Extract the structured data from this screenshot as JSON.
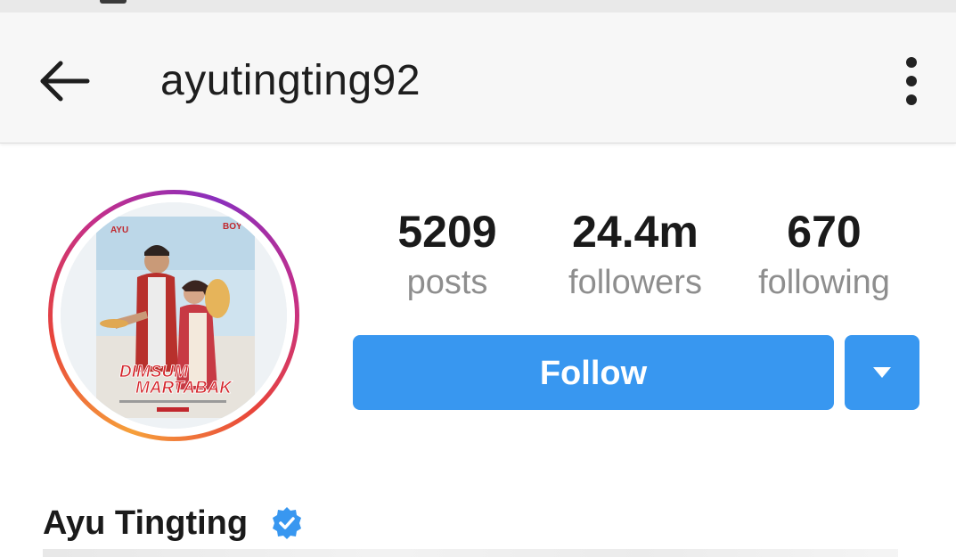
{
  "header": {
    "username": "ayutingting92",
    "back_icon": "arrow-back-icon",
    "menu_icon": "more-vertical-icon"
  },
  "profile": {
    "avatar_icon": "profile-picture",
    "poster_text": {
      "name_left": "AYU",
      "name_right": "BOY",
      "title_line1": "DIMSUM",
      "title_line2": "MARTABAK"
    },
    "full_name": "Ayu Tingting",
    "verified": true,
    "verified_icon": "verified-badge-icon"
  },
  "stats": [
    {
      "value": "5209",
      "label": "posts"
    },
    {
      "value": "24.4m",
      "label": "followers"
    },
    {
      "value": "670",
      "label": "following"
    }
  ],
  "actions": {
    "follow_label": "Follow",
    "dropdown_icon": "caret-down-icon"
  },
  "colors": {
    "accent": "#3897f0",
    "text": "#1a1a1a",
    "muted": "#8e8e8e",
    "toolbar_bg": "#f7f7f7"
  }
}
